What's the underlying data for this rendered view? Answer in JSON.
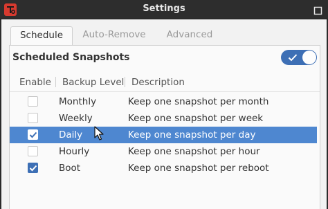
{
  "window": {
    "title": "Settings"
  },
  "tabs": [
    {
      "label": "Schedule",
      "active": true
    },
    {
      "label": "Auto-Remove",
      "active": false
    },
    {
      "label": "Advanced",
      "active": false
    }
  ],
  "section": {
    "title": "Scheduled Snapshots",
    "toggle_on": true
  },
  "table": {
    "headers": {
      "enable": "Enable",
      "level": "Backup Level",
      "description": "Description"
    },
    "rows": [
      {
        "enabled": false,
        "level": "Monthly",
        "description": "Keep one snapshot per month",
        "selected": false
      },
      {
        "enabled": false,
        "level": "Weekly",
        "description": "Keep one snapshot per week",
        "selected": false
      },
      {
        "enabled": true,
        "level": "Daily",
        "description": "Keep one snapshot per day",
        "selected": true
      },
      {
        "enabled": false,
        "level": "Hourly",
        "description": "Keep one snapshot per hour",
        "selected": false
      },
      {
        "enabled": true,
        "level": "Boot",
        "description": "Keep one snapshot per reboot",
        "selected": false
      }
    ]
  },
  "colors": {
    "accent": "#3d6fb5",
    "selection": "#4e87d0",
    "app_icon": "#d63a2f"
  }
}
